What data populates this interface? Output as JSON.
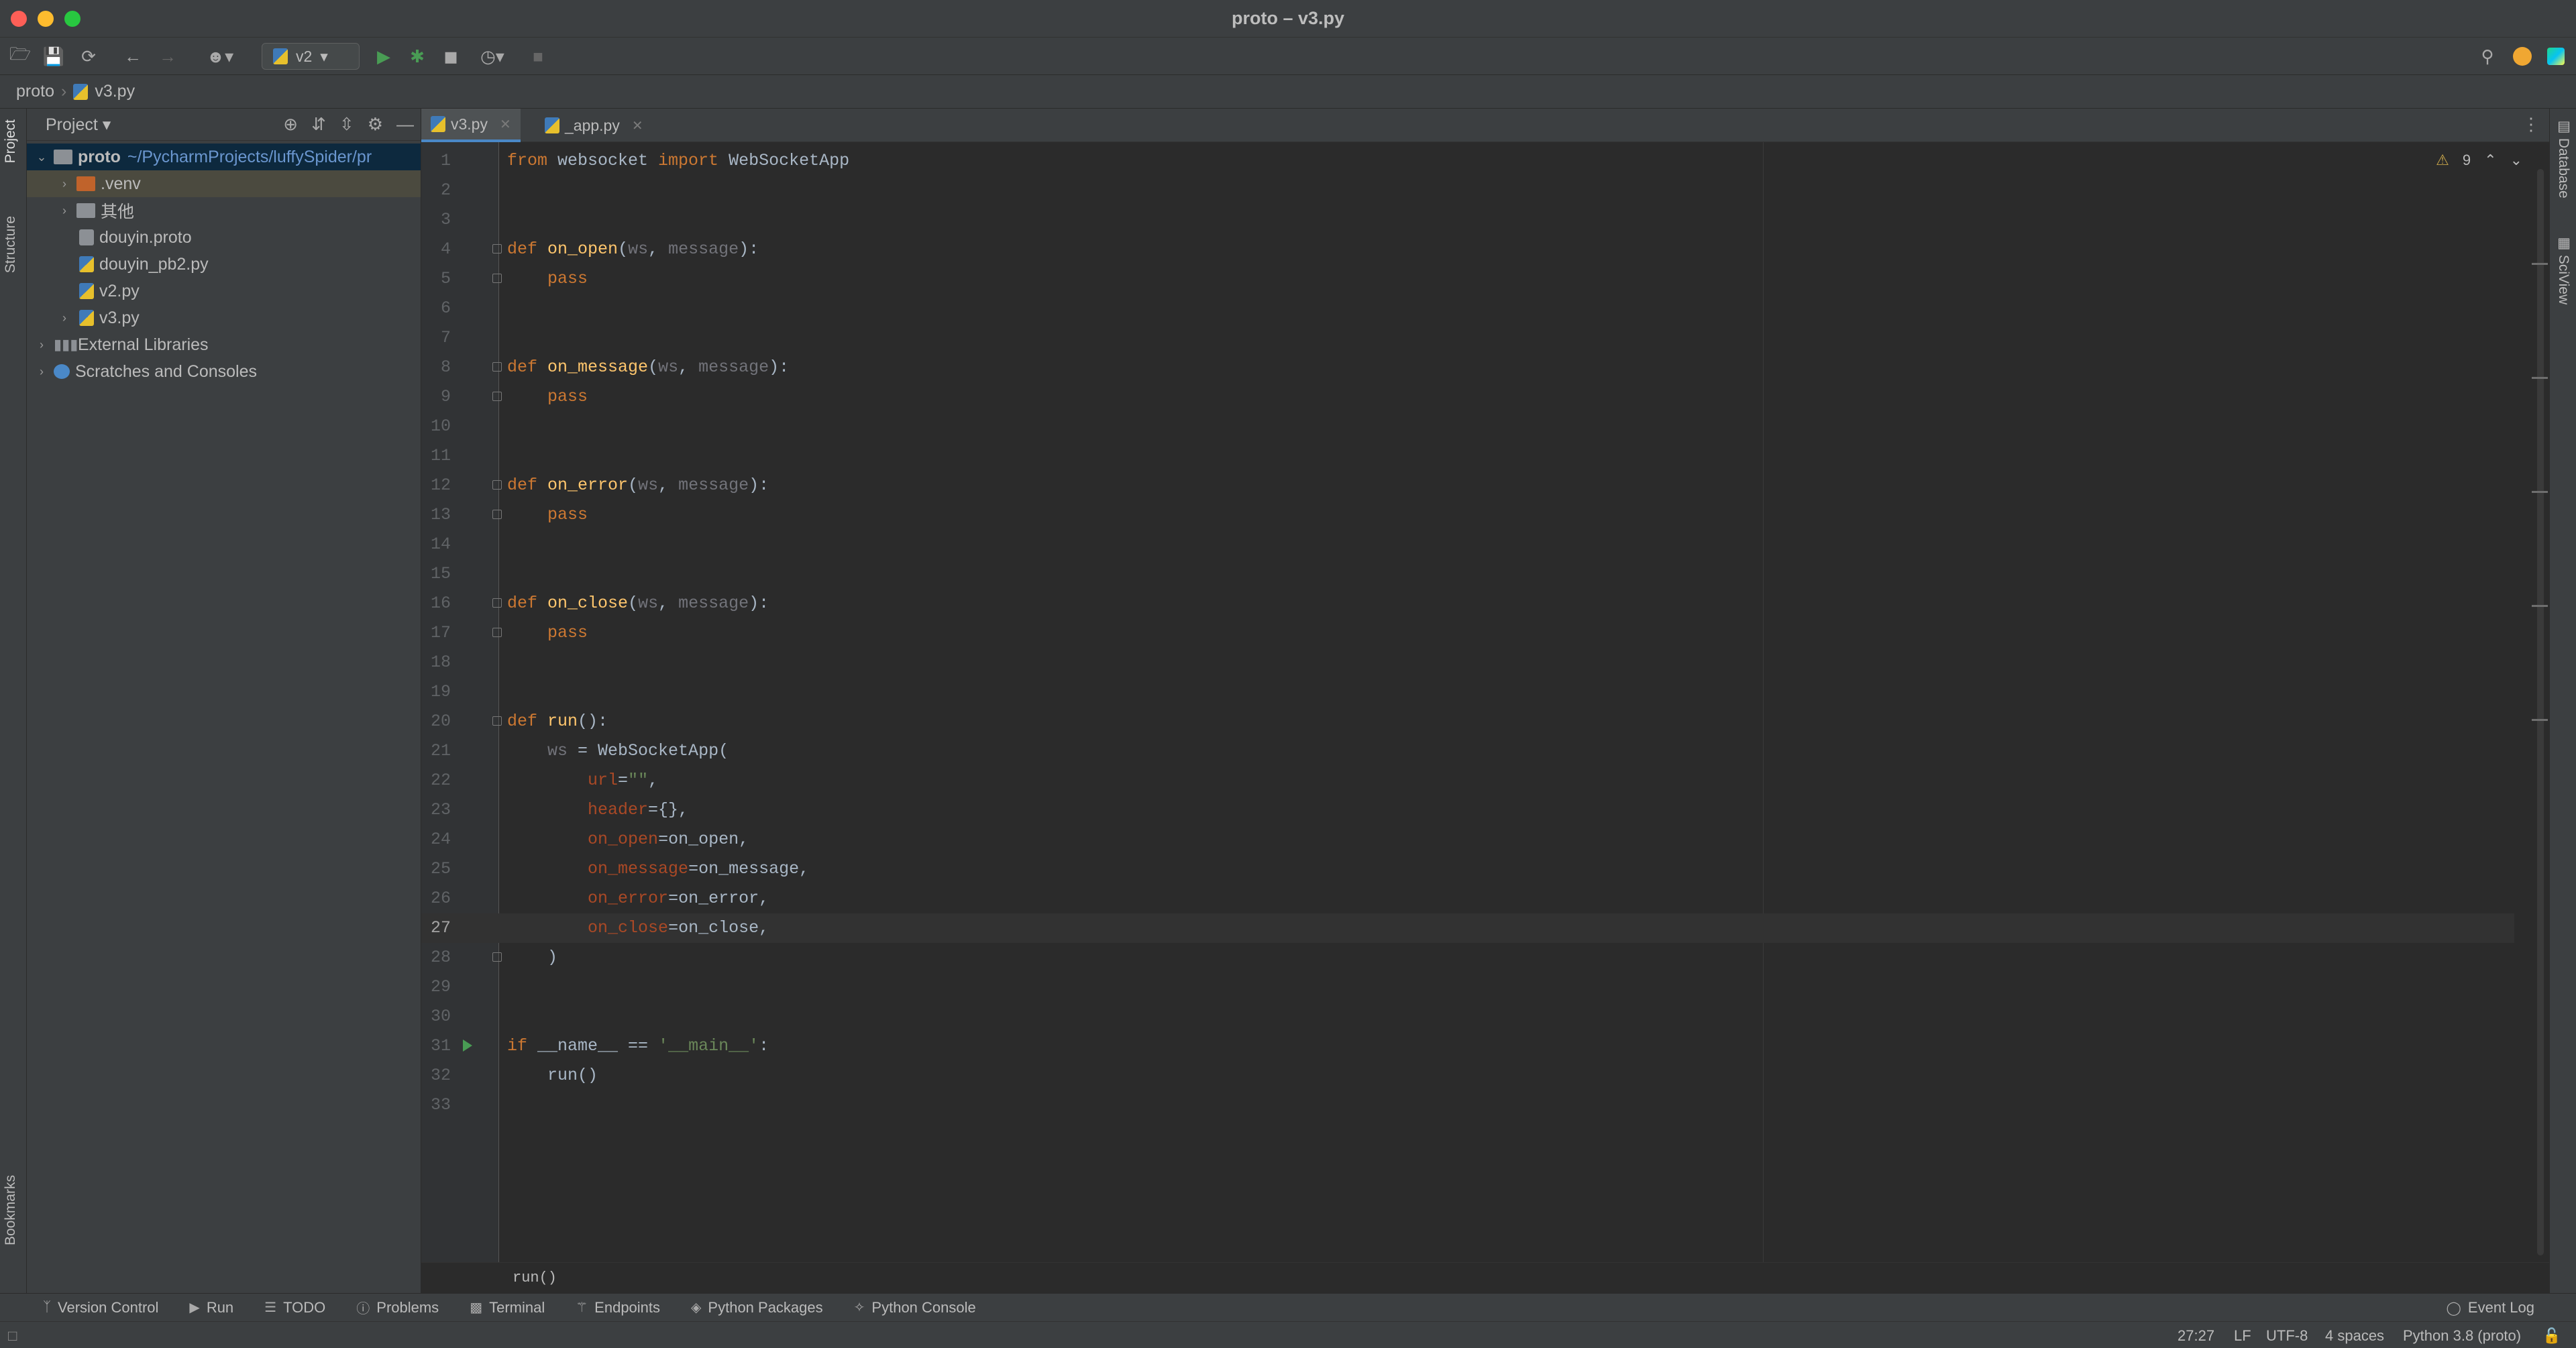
{
  "window": {
    "title": "proto – v3.py"
  },
  "toolbar": {
    "run_config": "v2"
  },
  "breadcrumb": {
    "project": "proto",
    "file": "v3.py"
  },
  "project_panel": {
    "title": "Project",
    "root": {
      "name": "proto",
      "path": "~/PycharmProjects/luffySpider/pr"
    },
    "items": [
      {
        "label": ".venv",
        "type": "folder"
      },
      {
        "label": "其他",
        "type": "folder"
      },
      {
        "label": "douyin.proto",
        "type": "file"
      },
      {
        "label": "douyin_pb2.py",
        "type": "file"
      },
      {
        "label": "v2.py",
        "type": "file"
      },
      {
        "label": "v3.py",
        "type": "file"
      }
    ],
    "external_libraries": "External Libraries",
    "scratches": "Scratches and Consoles"
  },
  "tabs": [
    {
      "label": "v3.py",
      "active": true
    },
    {
      "label": "_app.py",
      "active": false
    }
  ],
  "editor": {
    "warnings": "9",
    "current_line": 27,
    "breadcrumb": "run()",
    "line_count": 33
  },
  "left_tabs": {
    "project": "Project",
    "structure": "Structure",
    "bookmarks": "Bookmarks"
  },
  "right_tabs": {
    "database": "Database",
    "sciview": "SciView"
  },
  "tool_windows": {
    "version_control": "Version Control",
    "run": "Run",
    "todo": "TODO",
    "problems": "Problems",
    "terminal": "Terminal",
    "endpoints": "Endpoints",
    "python_packages": "Python Packages",
    "python_console": "Python Console",
    "event_log": "Event Log"
  },
  "status": {
    "position": "27:27",
    "line_sep": "LF",
    "encoding": "UTF-8",
    "indent": "4 spaces",
    "interpreter": "Python 3.8 (proto)"
  },
  "colors": {
    "accent": "#4a88c7",
    "keyword": "#cc7832",
    "function": "#ffc66d",
    "string": "#6a8759",
    "kwarg": "#aa4926"
  }
}
